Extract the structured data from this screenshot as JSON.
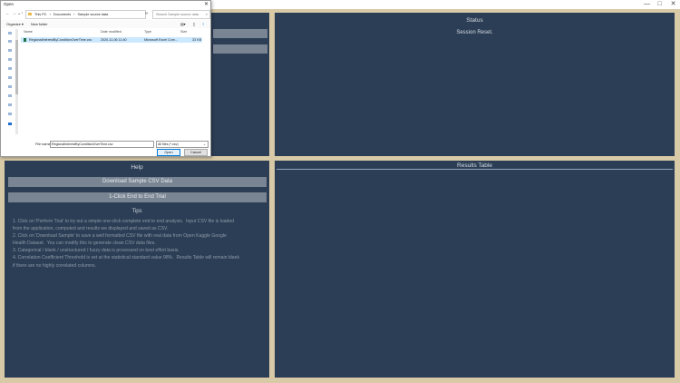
{
  "app": {
    "window_controls": [
      "—",
      "□",
      "✕"
    ],
    "status_panel": {
      "title": "Status",
      "message": "Session Reset."
    },
    "help_panel": {
      "title": "Help",
      "download_button": "Download Sample CSV Data",
      "trial_button": "1-Click End to End Trial",
      "tips_title": "Tips",
      "tips_text": "1. Click on 'Perform Trial' to try out a simple one-click complete end to end analysis.  Input CSV file is loaded\nfrom the application, computed and results we displayed and saved as CSV.\n2. Click on 'Download Sample' to save a well formatted CSV file with real data from Open Kaggle Google\nHealth Dataset.  You can modify this to generate clean CSV data files.\n3. Categorical / blank / unstructured / fuzzy data is processed on best effort basis.\n4. Correlation Coefficient Threshold is set at the statistical standard value 98%.  Results Table will remain blank\nif there are no highly correlated columns."
    },
    "results_panel": {
      "title": "Results Table"
    }
  },
  "dialog": {
    "title": "Open",
    "close": "✕",
    "nav": {
      "back": "←",
      "forward": "→",
      "up_list": "⌄",
      "up": "↑"
    },
    "address": [
      "This PC",
      "›",
      "Documents",
      "›",
      "Sample source data"
    ],
    "search_placeholder": "Search Sample source data",
    "toolbar": {
      "organize": "Organize ▾",
      "new_folder": "New folder"
    },
    "columns": {
      "name": "Name",
      "modified": "Date modified",
      "type": "Type",
      "size": "Size"
    },
    "files": [
      {
        "name": "RegionalInterestByConditionOverTime.csv",
        "modified": "2020-11-06 11:40",
        "type": "Microsoft Excel Com...",
        "size": "33 KB"
      }
    ],
    "filename_label": "File name:",
    "filename_value": "RegionalInterestByConditionOverTime.csv",
    "filetype": "All files (*.csv)",
    "open_button": "Open",
    "cancel_button": "Cancel"
  }
}
